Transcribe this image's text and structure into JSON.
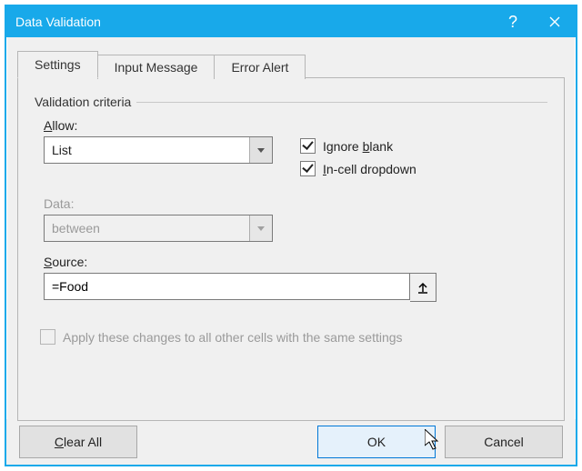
{
  "window": {
    "title": "Data Validation"
  },
  "tabs": {
    "settings": "Settings",
    "input_message": "Input Message",
    "error_alert": "Error Alert"
  },
  "group": {
    "criteria_label": "Validation criteria"
  },
  "allow": {
    "label_pre": "",
    "underline": "A",
    "label_post": "llow:",
    "value": "List"
  },
  "data": {
    "label": "Data:",
    "value": "between"
  },
  "checks": {
    "ignore_pre": "Ignore ",
    "ignore_u": "b",
    "ignore_post": "lank",
    "incell_u": "I",
    "incell_post": "n-cell dropdown"
  },
  "source": {
    "underline": "S",
    "label_post": "ource:",
    "value": "=Food"
  },
  "apply": {
    "underline": "P",
    "pre": "Apply these changes to all other cells with the same settings",
    "text": "Apply these changes to all other cells with the same settings"
  },
  "buttons": {
    "clear_u": "C",
    "clear_post": "lear All",
    "ok": "OK",
    "cancel": "Cancel"
  }
}
